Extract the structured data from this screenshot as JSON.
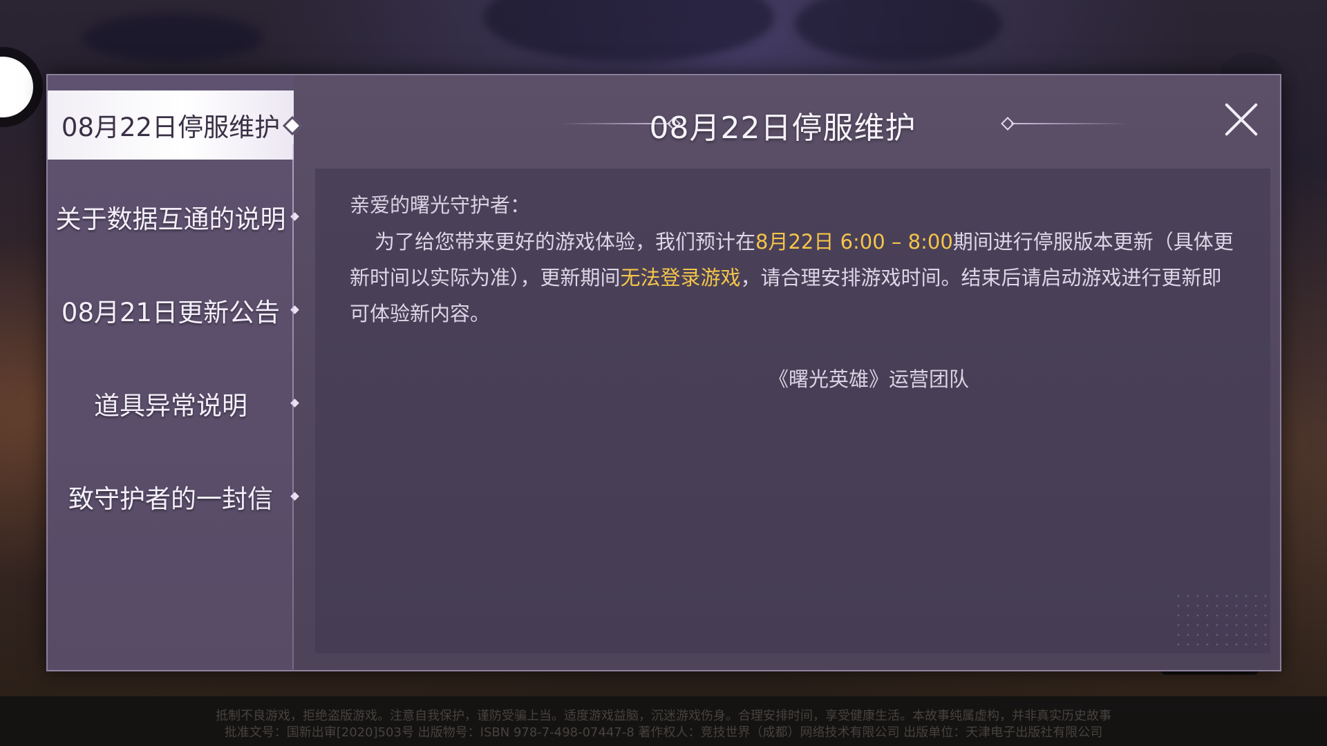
{
  "sidebar": {
    "items": [
      {
        "label": "08月22日停服维护",
        "active": true
      },
      {
        "label": "关于数据互通的说明",
        "active": false
      },
      {
        "label": "08月21日更新公告",
        "active": false
      },
      {
        "label": "道具异常说明",
        "active": false
      },
      {
        "label": "致守护者的一封信",
        "active": false
      }
    ]
  },
  "header": {
    "title": "08月22日停服维护",
    "close_icon": "close-icon"
  },
  "content": {
    "greeting": "亲爱的曙光守护者：",
    "body_1": "为了给您带来更好的游戏体验，我们预计在",
    "body_highlight_1": "8月22日 6:00 – 8:00",
    "body_2": "期间进行停服版本更新（具体更新时间以实际为准），更新期间",
    "body_highlight_2": "无法登录游戏",
    "body_3": "，请合理安排游戏时间。结束后请启动游戏进行更新即可体验新内容。",
    "signature": "《曙光英雄》运营团队"
  },
  "footer": {
    "line_1": "抵制不良游戏，拒绝盗版游戏。注意自我保护，谨防受骗上当。适度游戏益脑，沉迷游戏伤身。合理安排时间，享受健康生活。本故事纯属虚构，并非真实历史故事",
    "line_2": "批准文号：国新出审[2020]503号 出版物号：ISBN 978-7-498-07447-8 著作权人：竞技世界（成都）网络技术有限公司 出版单位：天津电子出版社有限公司"
  },
  "colors": {
    "highlight": "#f5c54a",
    "panel": "#51475e",
    "active_tab": "#ffffff"
  }
}
